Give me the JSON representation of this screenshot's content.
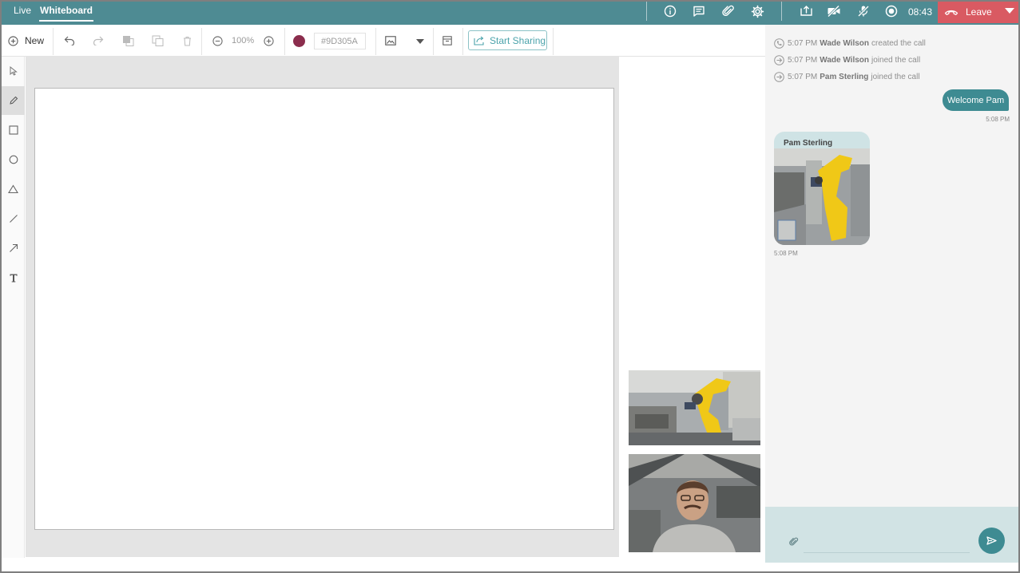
{
  "tabs": {
    "live": "Live",
    "whiteboard": "Whiteboard"
  },
  "topbar": {
    "icons": [
      "info-icon",
      "chat-icon",
      "attachment-icon",
      "settings-icon",
      "screen-share-icon",
      "camera-off-icon",
      "mic-off-icon",
      "record-icon"
    ],
    "time": "08:43",
    "leave_label": "Leave"
  },
  "toolbar": {
    "new_label": "New",
    "zoom": "100%",
    "color_hex": "#9D305A",
    "start_sharing": "Start Sharing"
  },
  "tools": [
    "select",
    "pen",
    "rectangle",
    "circle",
    "triangle",
    "line",
    "arrow",
    "text"
  ],
  "active_tool": "pen",
  "chat": {
    "system_messages": [
      {
        "time": "5:07 PM",
        "name": "Wade Wilson",
        "action": "created the call"
      },
      {
        "time": "5:07 PM",
        "name": "Wade Wilson",
        "action": "joined the call"
      },
      {
        "time": "5:07 PM",
        "name": "Pam Sterling",
        "action": "joined the call"
      }
    ],
    "my_message": {
      "text": "Welcome Pam",
      "time": "5:08 PM"
    },
    "their_message": {
      "sender": "Pam Sterling",
      "time": "5:08 PM"
    },
    "input_value": ""
  },
  "colors": {
    "accent": "#4e8b93",
    "leave": "#d95a62",
    "bubble": "#3e8b92",
    "selected_color": "#9D305A"
  }
}
